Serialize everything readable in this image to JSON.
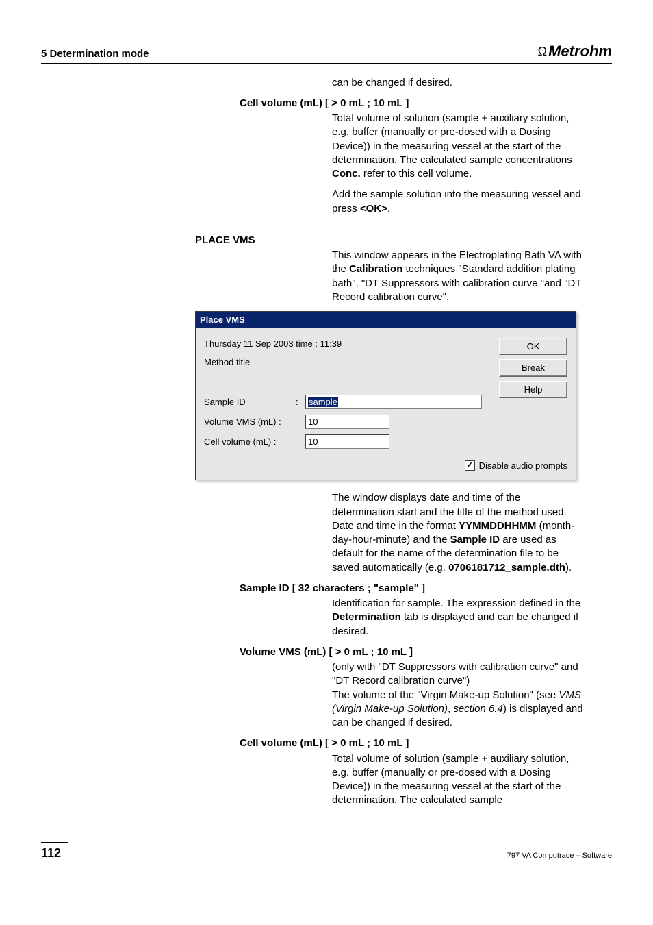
{
  "header": {
    "left": "5  Determination mode",
    "brand": "Metrohm"
  },
  "intro": {
    "line": "can be changed if desired."
  },
  "cell1": {
    "title": "Cell volume (mL)   [ > 0 mL ; 10 mL ]",
    "p1a": "Total volume of solution (sample + auxiliary solution, e.g. buffer (manually or pre-dosed with a Dosing Device)) in the measuring vessel at the start of the determination. The calculated sample concentrations ",
    "p1bold": "Conc.",
    "p1b": " refer to this cell volume.",
    "p2a": "Add the sample solution into the measuring vessel and press ",
    "p2bold": "<OK>",
    "p2b": "."
  },
  "placevms": {
    "heading": "PLACE VMS",
    "p1a": "This window appears in the Electroplating Bath VA with the ",
    "p1bold": "Calibration",
    "p1b": " techniques \"Standard addition plating bath\", \"DT Suppressors with calibration curve \"and \"DT Record calibration curve\"."
  },
  "dialog": {
    "title": "Place VMS",
    "datetime": "Thursday 11 Sep 2003  time : 11:39",
    "methodtitle_label": "Method title",
    "methodtitle_value": "",
    "sampleid_label": "Sample ID",
    "sampleid_value": "sample",
    "volvms_label": "Volume VMS (mL)  :",
    "volvms_value": "10",
    "cellvol_label": "Cell volume (mL)   :",
    "cellvol_value": "10",
    "ok": "OK",
    "break": "Break",
    "help": "Help",
    "disable_audio": "Disable audio prompts"
  },
  "after_dialog": {
    "p1a": "The window displays date and time of the determination start and the title of the method used. Date and time in the format ",
    "p1b1": "YYMMDDHHMM",
    "p1c": " (month-day-hour-minute) and the ",
    "p1b2": "Sample ID",
    "p1d": " are used as default for the name of the determination file to be saved automatically (e.g. ",
    "p1b3": "0706181712_sample.dth",
    "p1e": ")."
  },
  "sampleid": {
    "title": "Sample ID   [ 32 characters ; \"sample\" ]",
    "p1a": "Identification for sample. The expression defined in the ",
    "p1bold": "Determination",
    "p1b": " tab is displayed and can be changed if desired."
  },
  "volvms": {
    "title": "Volume VMS (mL)   [ > 0 mL ; 10 mL ]",
    "p1": "(only with \"DT Suppressors with calibration curve\" and \"DT Record calibration curve\")",
    "p2a": "The volume of the \"Virgin Make-up Solution\" (see ",
    "p2i": "VMS (Virgin Make-up Solution)",
    "p2b": ", ",
    "p2i2": "section 6.4",
    "p2c": ")  is displayed and can be changed if desired."
  },
  "cell2": {
    "title": "Cell volume (mL)   [ > 0 mL ; 10 mL ]",
    "p1": "Total volume of solution (sample + auxiliary solution, e.g. buffer (manually or pre-dosed with a Dosing Device)) in the measuring vessel at the start of the determination. The calculated sample"
  },
  "footer": {
    "page": "112",
    "right": "797 VA Computrace – Software"
  }
}
